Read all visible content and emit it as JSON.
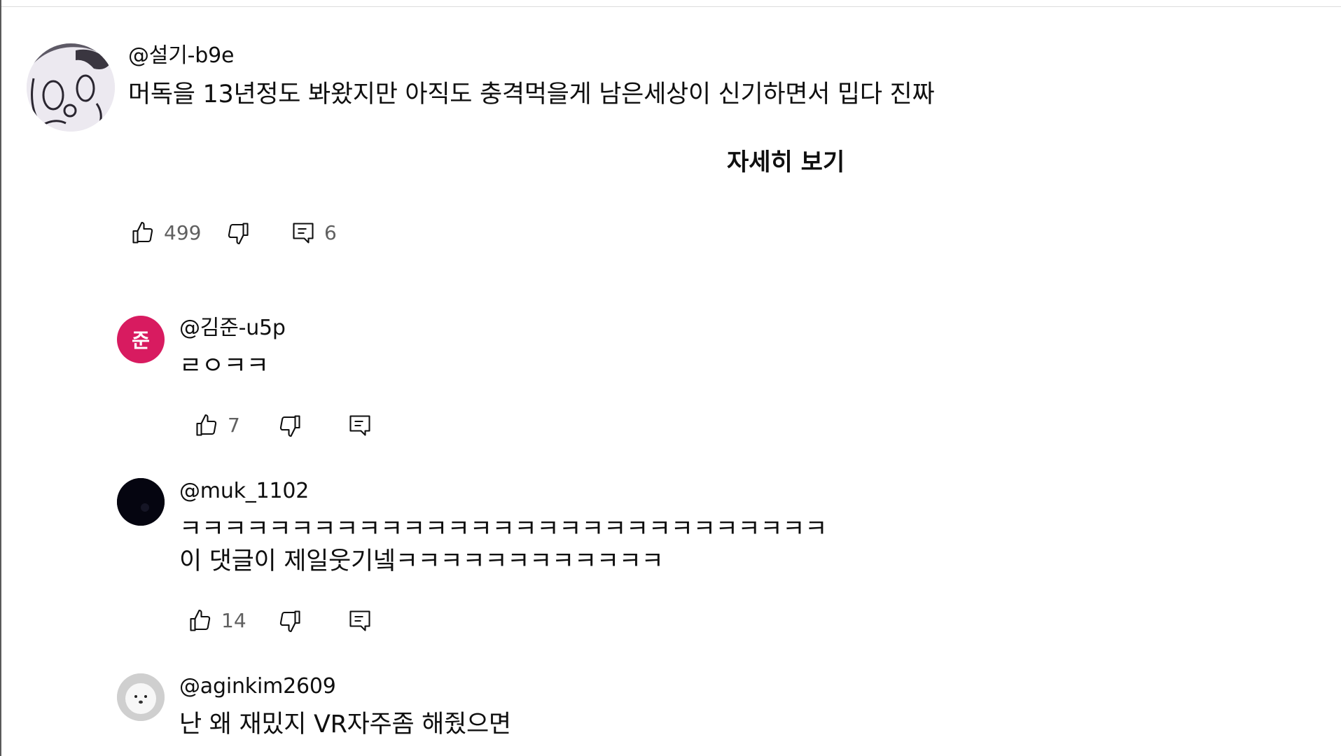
{
  "comments": [
    {
      "author": "@설기-b9e",
      "avatar": "cat-doodle-avatar",
      "text_lines": [
        "머독을 13년정도 봐왔지만 아직도 충격먹을게 남은세상이 신기하면서 밉다 진짜"
      ],
      "read_more": "자세히 보기",
      "likes": "499",
      "replies": "6"
    },
    {
      "author": "@김준-u5p",
      "avatar_letter": "준",
      "avatar_color": "#d81b60",
      "text_lines": [
        "ㄹㅇㅋㅋ"
      ],
      "likes": "7"
    },
    {
      "author": "@muk_1102",
      "avatar_color": "#050510",
      "text_lines": [
        "ㅋㅋㅋㅋㅋㅋㅋㅋㅋㅋㅋㅋㅋㅋㅋㅋㅋㅋㅋㅋㅋㅋㅋㅋㅋㅋㅋㅋㅋ",
        "이 댓글이 제일웃기넼ㅋㅋㅋㅋㅋㅋㅋㅋㅋㅋㅋㅋ"
      ],
      "likes": "14"
    },
    {
      "author": "@aginkim2609",
      "avatar": "white-dog-avatar",
      "text_lines": [
        "난 왜 재밌지 VR자주좀 해줬으면"
      ]
    }
  ],
  "icons": {
    "like": "thumbs-up-icon",
    "dislike": "thumbs-down-icon",
    "reply": "reply-icon"
  }
}
